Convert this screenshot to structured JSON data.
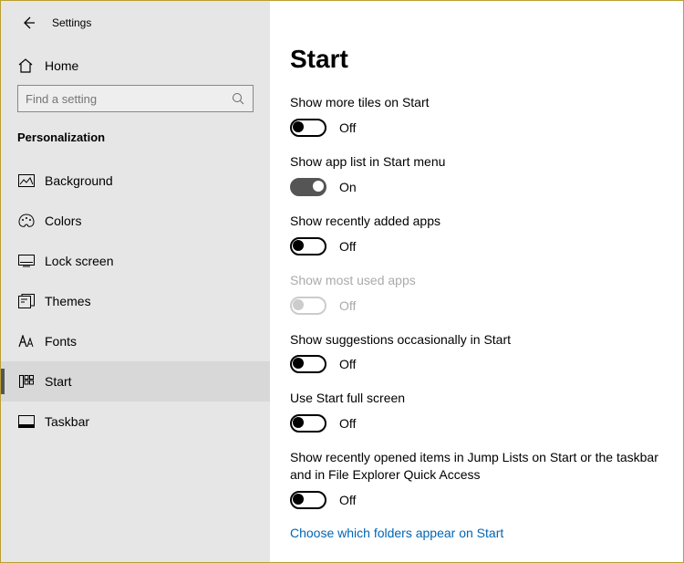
{
  "titlebar": {
    "title": "Settings"
  },
  "home": {
    "label": "Home"
  },
  "search": {
    "placeholder": "Find a setting"
  },
  "section": {
    "label": "Personalization"
  },
  "nav": [
    {
      "label": "Background"
    },
    {
      "label": "Colors"
    },
    {
      "label": "Lock screen"
    },
    {
      "label": "Themes"
    },
    {
      "label": "Fonts"
    },
    {
      "label": "Start"
    },
    {
      "label": "Taskbar"
    }
  ],
  "page": {
    "title": "Start"
  },
  "states": {
    "on": "On",
    "off": "Off"
  },
  "settings": [
    {
      "label": "Show more tiles on Start",
      "value": "off",
      "disabled": false
    },
    {
      "label": "Show app list in Start menu",
      "value": "on",
      "disabled": false
    },
    {
      "label": "Show recently added apps",
      "value": "off",
      "disabled": false
    },
    {
      "label": "Show most used apps",
      "value": "off",
      "disabled": true
    },
    {
      "label": "Show suggestions occasionally in Start",
      "value": "off",
      "disabled": false
    },
    {
      "label": "Use Start full screen",
      "value": "off",
      "disabled": false
    },
    {
      "label": "Show recently opened items in Jump Lists on Start or the taskbar and in File Explorer Quick Access",
      "value": "off",
      "disabled": false
    }
  ],
  "link": {
    "label": "Choose which folders appear on Start"
  }
}
